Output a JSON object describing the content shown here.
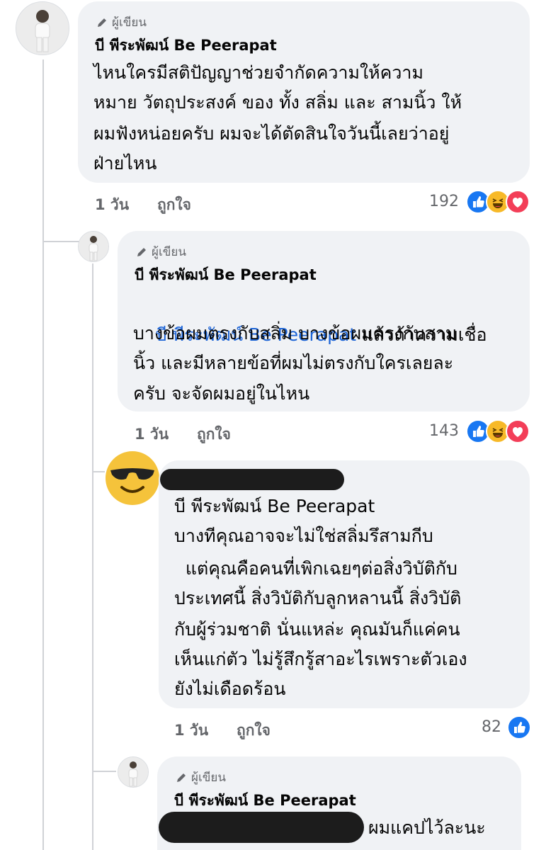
{
  "comments": [
    {
      "badge": "ผู้เขียน",
      "author": "บี พีระพัฒน์ Be Peerapat",
      "text_lines": [
        "ไหนใครมีสติปัญญาช่วยจำกัดความให้ความ",
        "หมาย วัตถุประสงค์ ของ ทั้ง สลิ่ม และ สามนิ้ว ให้",
        "ผมฟังหน่อยครับ ผมจะได้ตัดสินใจวันนี้เลยว่าอยู่",
        "ฝ่ายไหน"
      ],
      "time": "1 วัน",
      "like": "ถูกใจ",
      "reaction_count": "192",
      "reactions": [
        "like-icon",
        "haha-icon",
        "love-icon"
      ]
    },
    {
      "badge": "ผู้เขียน",
      "author": "บี พีระพัฒน์ Be Peerapat",
      "mention": "บี พีระพัฒน์ Be Peerapat",
      "text_first_rest": " แล้วถ้าความเชื่อ",
      "text_lines": [
        "บางข้อผมตรงกับสลิ่ม บางข้อผมตรงกับสาม",
        "นิ้ว และมีหลายข้อที่ผมไม่ตรงกับใครเลยละ",
        "ครับ จะจัดผมอยู่ในไหน"
      ],
      "time": "1 วัน",
      "like": "ถูกใจ",
      "reaction_count": "143",
      "reactions": [
        "like-icon",
        "haha-icon",
        "love-icon"
      ]
    },
    {
      "mention": "บี พีระพัฒน์ Be Peerapat",
      "text_lines": [
        "บางทีคุณอาจจะไม่ใช่สลิ่มรึสามกีบ",
        "  แต่คุณคือคนที่เพิกเฉยๆต่อสิ่งวิบัติกับ",
        "ประเทศนี้ สิ่งวิบัติกับลูกหลานนี้ สิ่งวิบัติ",
        "กับผู้ร่วมชาติ นั่นแหล่ะ คุณมันก็แค่คน",
        "เห็นแก่ตัว ไม่รู้สึกรู้สาอะไรเพราะตัวเอง",
        "ยังไม่เดือดร้อน"
      ],
      "time": "1 วัน",
      "like": "ถูกใจ",
      "reaction_count": "82",
      "reactions": [
        "like-icon"
      ]
    },
    {
      "badge": "ผู้เขียน",
      "author": "บี พีระพัฒน์ Be Peerapat",
      "text_tail": "ผมแคปไว้ละนะ"
    }
  ],
  "colors": {
    "bubble": "#f0f2f5",
    "mention": "#1b63d6",
    "like": "#1877f2",
    "haha": "#f7b928",
    "love": "#f33e58"
  }
}
